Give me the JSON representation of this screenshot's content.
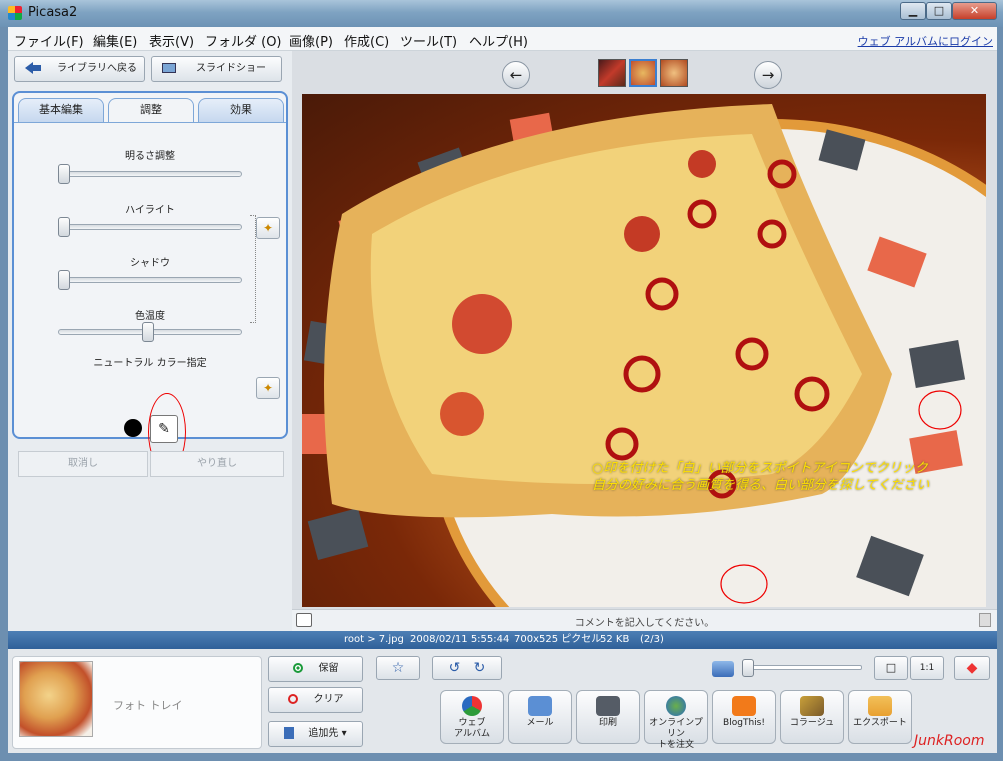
{
  "window": {
    "title": "Picasa2",
    "minimize": "▁",
    "maximize": "□",
    "close": "✕"
  },
  "menu": {
    "items": [
      "ファイル(F)",
      "編集(E)",
      "表示(V)",
      "フォルダ (O)",
      "画像(P)",
      "作成(C)",
      "ツール(T)",
      "ヘルプ(H)"
    ],
    "login_link": "ウェブ アルバムにログイン"
  },
  "left": {
    "back_button": "ライブラリへ戻る",
    "slideshow_button": "スライドショー",
    "tabs": [
      "基本編集",
      "調整",
      "効果"
    ],
    "sliders": {
      "brightness": {
        "label": "明るさ調整",
        "value": 0.0
      },
      "highlight": {
        "label": "ハイライト",
        "value": 0.0
      },
      "shadow": {
        "label": "シャドウ",
        "value": 0.0
      },
      "color_temp": {
        "label": "色温度",
        "value": 0.5
      }
    },
    "neutral_label": "ニュートラル カラー指定",
    "undo": "取消し",
    "redo": "やり直し",
    "icons": {
      "wand": "magic-wand-icon",
      "dropper": "eyedropper-icon"
    }
  },
  "viewer": {
    "prev_icon": "←",
    "next_icon": "→",
    "caption_line1": "○印を付けた「白」い部分をスポイトアイコンでクリック",
    "caption_line2": "自分の好みに合う画質を得る、白い部分を探してください",
    "comment_placeholder": "コメントを記入してください。"
  },
  "info": {
    "path": "root > 7.jpg",
    "date": "2008/02/11 5:55:44",
    "size": "700x525 ピクセル",
    "filesize": "52 KB",
    "index": "(2/3)"
  },
  "bottom": {
    "tray_label": "フォト トレイ",
    "hold": "保留",
    "clear": "クリア",
    "add_to": "追加先",
    "zoom_fit": "□",
    "zoom_1to1": "1:1",
    "actions": [
      {
        "label1": "ウェブ",
        "label2": "アルバム",
        "color": "#2d9b3a"
      },
      {
        "label1": "メール",
        "label2": "",
        "color": "#5b8fd4"
      },
      {
        "label1": "印刷",
        "label2": "",
        "color": "#555c66"
      },
      {
        "label1": "オンラインプリン",
        "label2": "トを注文",
        "color": "#2a6ac0"
      },
      {
        "label1": "BlogThis!",
        "label2": "",
        "color": "#f27a1a"
      },
      {
        "label1": "コラージュ",
        "label2": "",
        "color": "#c9a03a"
      },
      {
        "label1": "エクスポート",
        "label2": "",
        "color": "#e8a030"
      }
    ],
    "watermark": "JunkRoom"
  }
}
